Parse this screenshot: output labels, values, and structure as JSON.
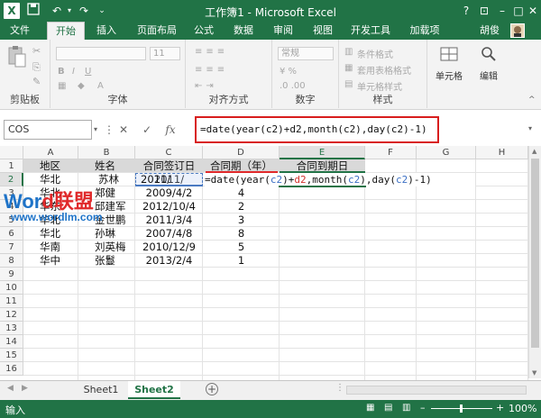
{
  "window": {
    "title": "工作簿1 - Microsoft Excel"
  },
  "ribbon_tabs": [
    "文件",
    "开始",
    "插入",
    "页面布局",
    "公式",
    "数据",
    "审阅",
    "视图",
    "开发工具",
    "加载项"
  ],
  "user": "胡俊",
  "ribbon": {
    "clipboard_label": "剪贴板",
    "font_label": "字体",
    "font_size": "11",
    "alignment_label": "对齐方式",
    "number_format": "常规",
    "number_label": "数字",
    "conditional_format": "条件格式",
    "table_format": "套用表格格式",
    "cell_style": "单元格样式",
    "styles_label": "样式",
    "cells_label": "单元格",
    "edit_label": "编辑"
  },
  "name_box": "COS",
  "formula_bar": {
    "fx": "fx",
    "formula": "=date(year(c2)+d2,month(c2),day(c2)-1)"
  },
  "columns": [
    "A",
    "B",
    "C",
    "D",
    "E",
    "F",
    "G",
    "H"
  ],
  "rows": [
    "1",
    "2",
    "3",
    "4",
    "5",
    "6",
    "7",
    "8",
    "9",
    "10",
    "11",
    "12",
    "13",
    "14",
    "15",
    "16"
  ],
  "table": {
    "headers": [
      "地区",
      "姓名",
      "合同签订日",
      "合同期（年）",
      "合同到期日"
    ],
    "data": [
      [
        "华北",
        "苏林",
        "2011/",
        "",
        ""
      ],
      [
        "华北",
        "郑健",
        "2009/4/2",
        "4",
        ""
      ],
      [
        "华东",
        "邱建军",
        "2012/10/4",
        "2",
        ""
      ],
      [
        "华北",
        "金世鹏",
        "2011/3/4",
        "3",
        ""
      ],
      [
        "华北",
        "孙琳",
        "2007/4/8",
        "8",
        ""
      ],
      [
        "华南",
        "刘英梅",
        "2010/12/9",
        "5",
        ""
      ],
      [
        "华中",
        "张鬘",
        "2013/2/4",
        "1",
        ""
      ]
    ],
    "editing_formula": {
      "pre": "=date(year(",
      "c2a": "c2",
      "mid1": ")+",
      "d2": "d2",
      "mid2": ",month(",
      "c2b": "c2",
      "mid3": "),day(",
      "c2c": "c2",
      "post": ")-1)"
    }
  },
  "sheets": [
    "Sheet1",
    "Sheet2"
  ],
  "status": {
    "mode": "输入",
    "zoom": "100%"
  },
  "watermark": {
    "text1": "Word联盟",
    "text2": "www.wordlm.com"
  }
}
